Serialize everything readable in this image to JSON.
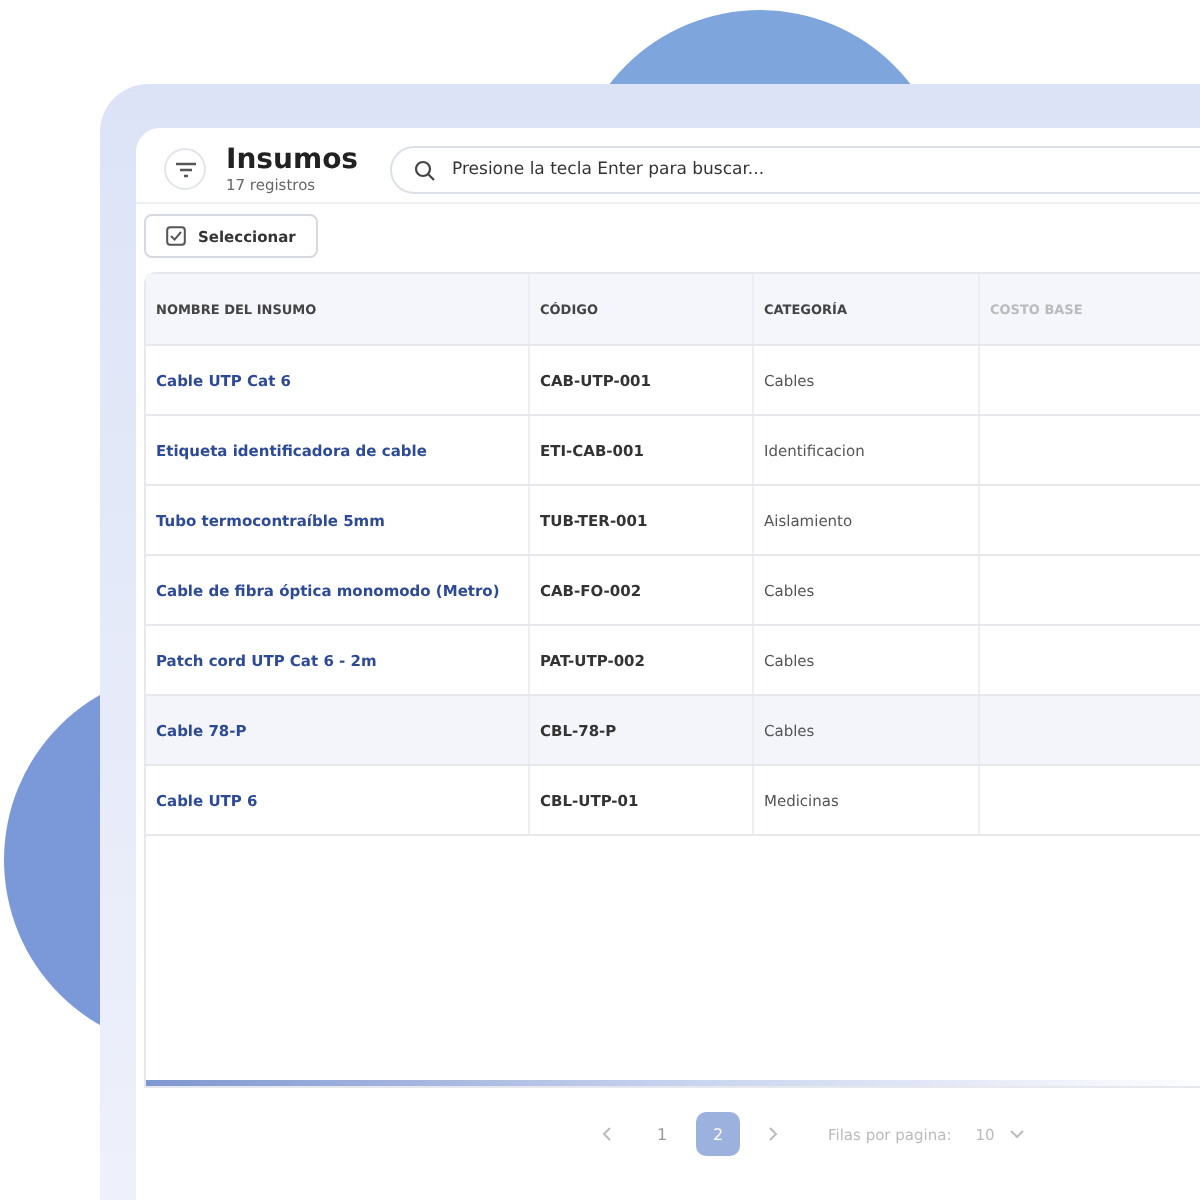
{
  "header": {
    "title": "Insumos",
    "subtitle": "17 registros"
  },
  "search": {
    "placeholder": "Presione la tecla Enter para buscar..."
  },
  "select_button": {
    "label": "Seleccionar"
  },
  "table": {
    "columns": [
      "NOMBRE DEL INSUMO",
      "CÓDIGO",
      "CATEGORÍA",
      "COSTO BASE"
    ],
    "rows": [
      {
        "name": "Cable UTP Cat 6",
        "code": "CAB-UTP-001",
        "category": "Cables",
        "selected": false
      },
      {
        "name": "Etiqueta identificadora de cable",
        "code": "ETI-CAB-001",
        "category": "Identificacion",
        "selected": false
      },
      {
        "name": "Tubo termocontraíble 5mm",
        "code": "TUB-TER-001",
        "category": "Aislamiento",
        "selected": false
      },
      {
        "name": "Cable de fibra óptica monomodo (Metro)",
        "code": "CAB-FO-002",
        "category": "Cables",
        "selected": false
      },
      {
        "name": "Patch cord UTP Cat 6 - 2m",
        "code": "PAT-UTP-002",
        "category": "Cables",
        "selected": false
      },
      {
        "name": "Cable 78-P",
        "code": "CBL-78-P",
        "category": "Cables",
        "selected": true
      },
      {
        "name": "Cable UTP 6",
        "code": "CBL-UTP-01",
        "category": "Medicinas",
        "selected": false
      }
    ]
  },
  "pagination": {
    "pages": [
      {
        "label": "1",
        "selected": false
      },
      {
        "label": "2",
        "selected": true
      }
    ],
    "rows_label": "Filas por pagina:",
    "rows_value": "10"
  }
}
